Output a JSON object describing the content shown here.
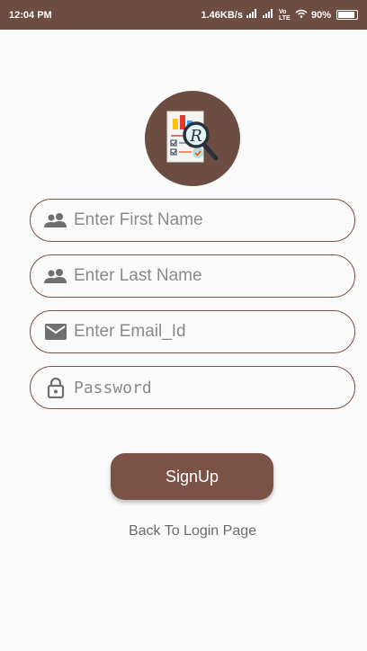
{
  "status_bar": {
    "time": "12:04 PM",
    "network_speed": "1.46KB/s",
    "signal_icon_1": "signal-icon",
    "signal_icon_2": "signal-icon",
    "volte_label": "Vo LTE",
    "wifi_icon": "wifi-icon",
    "battery_percent": "90%"
  },
  "logo": {
    "icon": "report-search-icon",
    "letter": "R",
    "bg_color": "#6d4c41"
  },
  "form": {
    "first_name": {
      "placeholder": "Enter First Name",
      "value": "",
      "icon": "people-icon"
    },
    "last_name": {
      "placeholder": "Enter Last Name",
      "value": "",
      "icon": "people-icon"
    },
    "email": {
      "placeholder": "Enter Email_Id",
      "value": "",
      "icon": "mail-icon"
    },
    "password": {
      "placeholder": "Password",
      "value": "",
      "icon": "lock-icon"
    }
  },
  "signup_button": {
    "label": "SignUp",
    "color": "#7a5246"
  },
  "back_link": {
    "label": "Back To Login Page"
  }
}
